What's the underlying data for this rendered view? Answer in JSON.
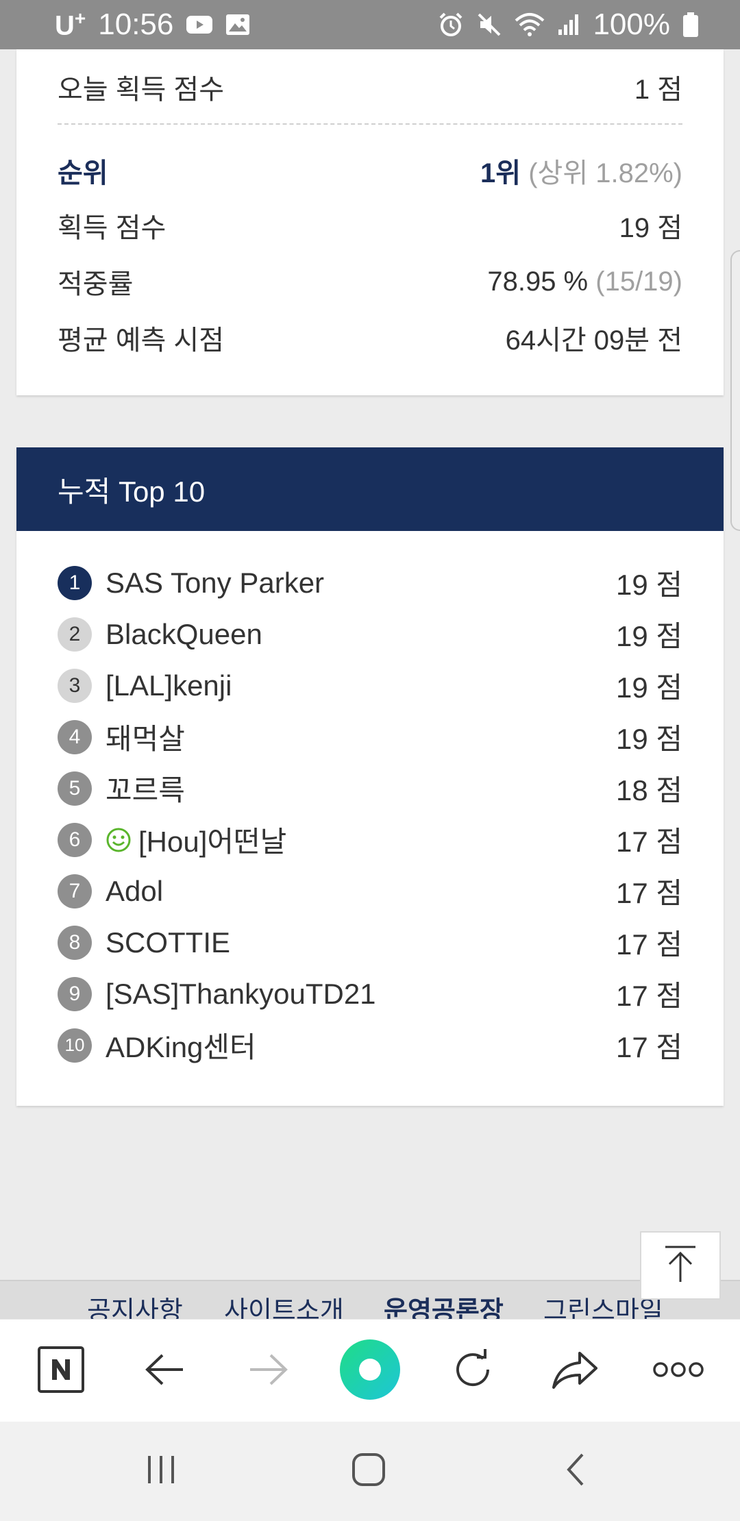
{
  "status_bar": {
    "carrier": "U",
    "carrier_sup": "+",
    "time": "10:56",
    "battery": "100%",
    "icons_left": [
      "youtube-icon",
      "gallery-icon"
    ],
    "icons_right": [
      "alarm-icon",
      "mute-icon",
      "wifi-icon",
      "signal-icon",
      "battery-icon"
    ]
  },
  "stats": {
    "today_label": "오늘 획득 점수",
    "today_value": "1 점",
    "rank_label": "순위",
    "rank_value": "1위",
    "rank_extra": "(상위 1.82%)",
    "points_label": "획득 점수",
    "points_value": "19 점",
    "accuracy_label": "적중률",
    "accuracy_value": "78.95 %",
    "accuracy_extra": "(15/19)",
    "avg_time_label": "평균 예측 시점",
    "avg_time_value": "64시간 09분 전"
  },
  "top10": {
    "title": "누적 Top 10",
    "items": [
      {
        "rank": "1",
        "name": "SAS Tony Parker",
        "score": "19 점"
      },
      {
        "rank": "2",
        "name": "BlackQueen",
        "score": "19 점"
      },
      {
        "rank": "3",
        "name": "[LAL]kenji",
        "score": "19 점"
      },
      {
        "rank": "4",
        "name": "돼먹살",
        "score": "19 점"
      },
      {
        "rank": "5",
        "name": "꼬르륵",
        "score": "18 점"
      },
      {
        "rank": "6",
        "name": "[Hou]어떤날",
        "score": "17 점"
      },
      {
        "rank": "7",
        "name": "Adol",
        "score": "17 점"
      },
      {
        "rank": "8",
        "name": "SCOTTIE",
        "score": "17 점"
      },
      {
        "rank": "9",
        "name": "[SAS]ThankyouTD21",
        "score": "17 점"
      },
      {
        "rank": "10",
        "name": "ADKing센터",
        "score": "17 점"
      }
    ]
  },
  "footer": {
    "links": [
      "공지사항",
      "사이트소개",
      "운영공론장",
      "그린스마일"
    ]
  },
  "browser_toolbar": {
    "buttons": [
      "naver-home",
      "back",
      "forward",
      "green-dot",
      "reload",
      "share",
      "more"
    ]
  },
  "nav_bar": {
    "buttons": [
      "recents",
      "home",
      "back"
    ]
  },
  "colors": {
    "navy": "#182f5c",
    "green_accent": "#2bd4a0",
    "smile_green": "#5ab52c"
  }
}
